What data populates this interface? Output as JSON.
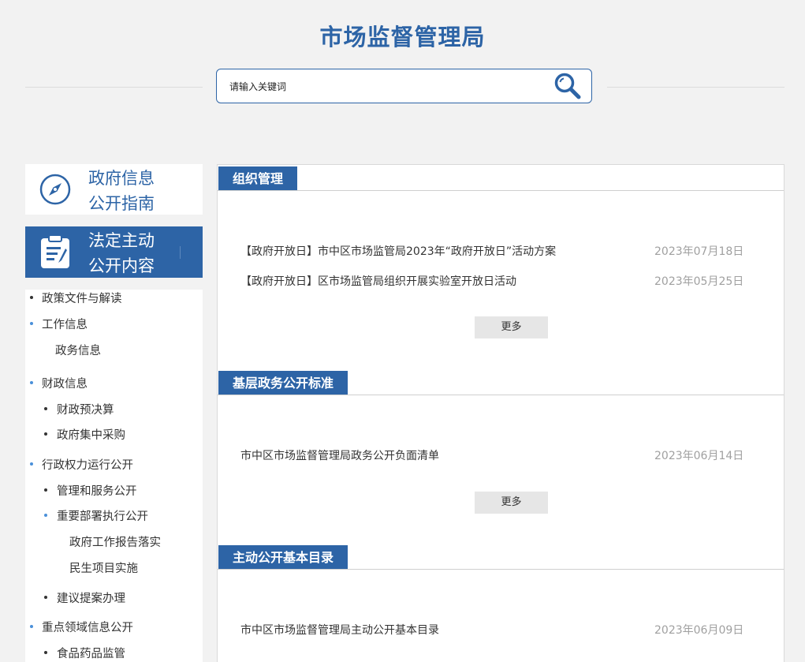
{
  "header": {
    "site_title": "市场监督管理局",
    "search_placeholder": "请输入关键词"
  },
  "sidebar": {
    "guide_card": {
      "line1": "政府信息",
      "line2": "公开指南",
      "icon": "compass-icon"
    },
    "active_card": {
      "line1": "法定主动",
      "line2": "公开内容",
      "icon": "clipboard-icon"
    },
    "menu": [
      {
        "label": "政策文件与解读"
      },
      {
        "label": "工作信息"
      },
      {
        "label": "政务信息"
      },
      {
        "label": "财政信息"
      },
      {
        "label": "财政预决算"
      },
      {
        "label": "政府集中采购"
      },
      {
        "label": "行政权力运行公开"
      },
      {
        "label": "管理和服务公开"
      },
      {
        "label": "重要部署执行公开"
      },
      {
        "label": "政府工作报告落实"
      },
      {
        "label": "民生项目实施"
      },
      {
        "label": "建议提案办理"
      },
      {
        "label": "重点领域信息公开"
      },
      {
        "label": "食品药品监管"
      }
    ]
  },
  "sections": [
    {
      "title": "组织管理",
      "items": [
        {
          "title": "【政府开放日】市中区市场监管局2023年“政府开放日”活动方案",
          "date": "2023年07月18日"
        },
        {
          "title": "【政府开放日】区市场监管局组织开展实验室开放日活动",
          "date": "2023年05月25日"
        }
      ],
      "more": "更多"
    },
    {
      "title": "基层政务公开标准",
      "items": [
        {
          "title": "市中区市场监督管理局政务公开负面清单",
          "date": "2023年06月14日"
        }
      ],
      "more": "更多"
    },
    {
      "title": "主动公开基本目录",
      "items": [
        {
          "title": "市中区市场监督管理局主动公开基本目录",
          "date": "2023年06月09日"
        }
      ]
    }
  ],
  "colors": {
    "accent": "#2d64a6",
    "date": "#a0a0a0",
    "bullet_blue": "#4a90d9"
  }
}
